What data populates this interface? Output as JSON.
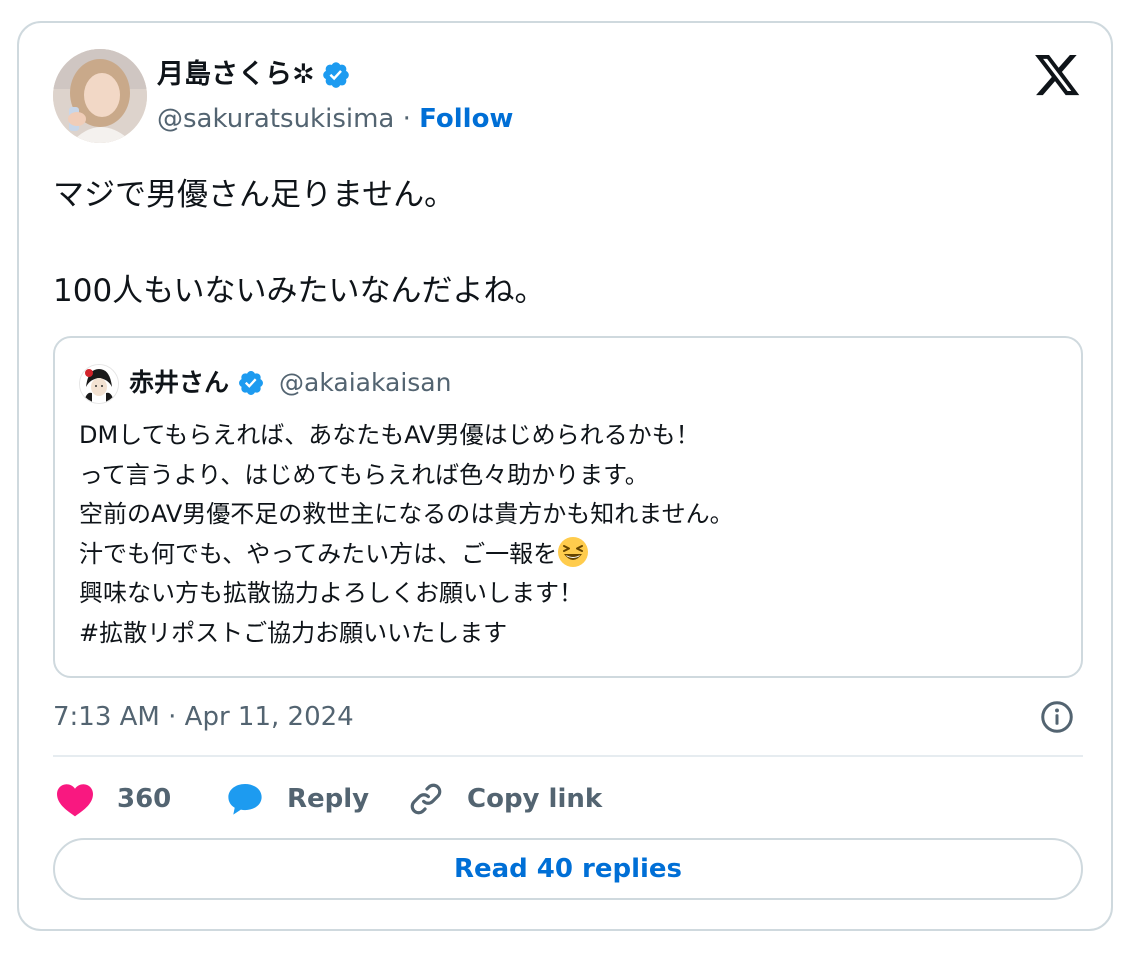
{
  "author": {
    "name": "月島さくら✲",
    "handle": "@sakuratsukisima",
    "separator": " · ",
    "follow_label": "Follow",
    "verified": true
  },
  "tweet": {
    "text": "マジで男優さん足りません。\n\n100人もいないみたいなんだよね。",
    "timestamp": "7:13 AM · Apr 11, 2024"
  },
  "quoted_tweet": {
    "name": "赤井さん",
    "handle": "@akaiakaisan",
    "verified": true,
    "body_before_emoji": "DMしてもらえれば、あなたもAV男優はじめられるかも！\nって言うより、はじめてもらえれば色々助かります。\n空前のAV男優不足の救世主になるのは貴方かも知れません。\n汁でも何でも、やってみたい方は、ご一報を",
    "body_after_emoji": "\n興味ない方も拡散協力よろしくお願いします！\n#拡散リポストご協力お願いいたします",
    "emoji": "laughing-face-emoji"
  },
  "actions": {
    "like_count": "360",
    "reply_label": "Reply",
    "copy_link_label": "Copy link"
  },
  "read_replies_label": "Read 40 replies",
  "colors": {
    "link": "#006fd6",
    "secondary_text": "#536471",
    "like": "#f91880",
    "reply": "#1d9bf0",
    "verified": "#1d9bf0",
    "border": "#cfd9de"
  },
  "icons": [
    "verified-badge-icon",
    "x-logo-icon",
    "info-icon",
    "heart-icon",
    "reply-bubble-icon",
    "link-icon"
  ]
}
